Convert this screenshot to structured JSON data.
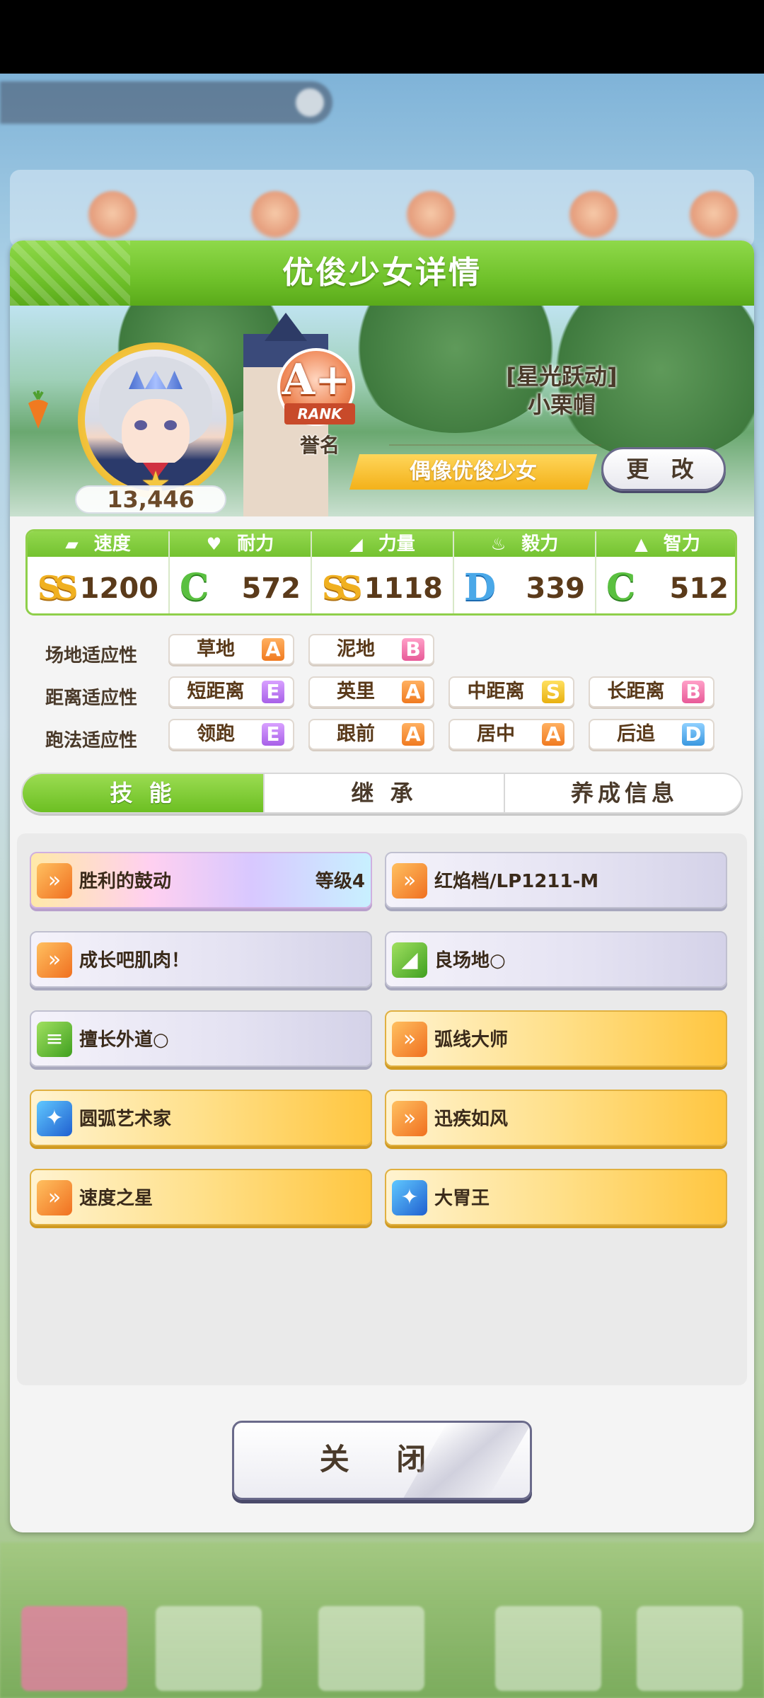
{
  "dialog": {
    "title": "优俊少女详情",
    "close_label": "关 闭"
  },
  "profile": {
    "rating": "13,446",
    "rank_letter": "A+",
    "rank_ribbon": "RANK",
    "rank_name": "誉名",
    "epithet": "[星光跃动]",
    "name": "小栗帽",
    "type_label": "偶像优俊少女",
    "change_label": "更 改"
  },
  "stats": [
    {
      "label": "速度",
      "icon": "shoe-icon",
      "grade": "SS",
      "value": "1200"
    },
    {
      "label": "耐力",
      "icon": "heart-icon",
      "grade": "C",
      "value": "572"
    },
    {
      "label": "力量",
      "icon": "muscle-icon",
      "grade": "SS",
      "value": "1118"
    },
    {
      "label": "毅力",
      "icon": "flame-icon",
      "grade": "D",
      "value": "339"
    },
    {
      "label": "智力",
      "icon": "graduation-cap-icon",
      "grade": "C",
      "value": "512"
    }
  ],
  "aptitude": {
    "track_label": "场地适应性",
    "distance_label": "距离适应性",
    "style_label": "跑法适应性",
    "track": [
      {
        "name": "草地",
        "grade": "A"
      },
      {
        "name": "泥地",
        "grade": "B"
      }
    ],
    "distance": [
      {
        "name": "短距离",
        "grade": "E"
      },
      {
        "name": "英里",
        "grade": "A"
      },
      {
        "name": "中距离",
        "grade": "S"
      },
      {
        "name": "长距离",
        "grade": "B"
      }
    ],
    "style": [
      {
        "name": "领跑",
        "grade": "E"
      },
      {
        "name": "跟前",
        "grade": "A"
      },
      {
        "name": "居中",
        "grade": "A"
      },
      {
        "name": "后追",
        "grade": "D"
      }
    ]
  },
  "tabs": [
    "技 能",
    "继 承",
    "养成信息"
  ],
  "skills": [
    {
      "name": "胜利的鼓动",
      "level": "等级4",
      "style": "rainbow",
      "icon": "speed-icon"
    },
    {
      "name": "红焰档/LP1211-M",
      "level": "",
      "style": "lav",
      "icon": "speed-icon"
    },
    {
      "name": "成长吧肌肉！",
      "level": "",
      "style": "lav",
      "icon": "speed-icon"
    },
    {
      "name": "良场地○",
      "level": "",
      "style": "lav",
      "icon": "muscle-icon"
    },
    {
      "name": "擅长外道○",
      "level": "",
      "style": "lav",
      "icon": "lane-icon"
    },
    {
      "name": "弧线大师",
      "level": "",
      "style": "gold",
      "icon": "speed-icon"
    },
    {
      "name": "圆弧艺术家",
      "level": "",
      "style": "gold",
      "icon": "sparkle-icon"
    },
    {
      "name": "迅疾如风",
      "level": "",
      "style": "gold",
      "icon": "speed-icon"
    },
    {
      "name": "速度之星",
      "level": "",
      "style": "gold",
      "icon": "speed-icon"
    },
    {
      "name": "大胃王",
      "level": "",
      "style": "gold",
      "icon": "sparkle-icon"
    }
  ]
}
